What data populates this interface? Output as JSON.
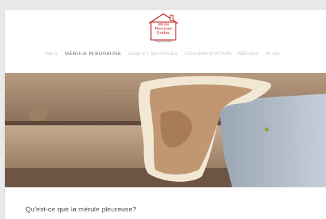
{
  "logo": {
    "lines": [
      "Mérule",
      "Pleureuse",
      "Québec"
    ],
    "subtitle": "Regroupement"
  },
  "nav": {
    "items": [
      {
        "label": "Info",
        "active": false
      },
      {
        "label": "Mérule pleureuse",
        "active": true
      },
      {
        "label": "Aide et services",
        "active": false
      },
      {
        "label": "Documentation",
        "active": false
      },
      {
        "label": "Médias",
        "active": false
      },
      {
        "label": "Plus",
        "active": false
      }
    ]
  },
  "hero": {
    "description_icon": "fungus-photo"
  },
  "content": {
    "heading": "Qu’est-ce que la mérule pleureuse?"
  },
  "colors": {
    "logo_red": "#c62828",
    "nav_active": "#7a7a7a",
    "nav_inactive": "#c9c9c9"
  }
}
